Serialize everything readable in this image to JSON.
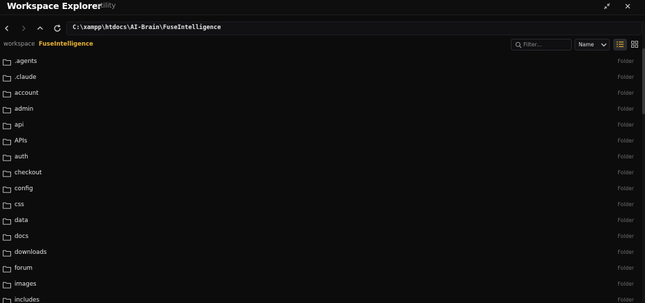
{
  "window": {
    "title": "Workspace Explorer",
    "subtitle": "utility"
  },
  "path": {
    "value": "C:\\xampp\\htdocs\\AI-Brain\\FuseIntelligence"
  },
  "breadcrumb": {
    "root": "workspace",
    "current": "FuseIntelligence"
  },
  "filter": {
    "placeholder": "Filter..."
  },
  "sort": {
    "label": "Name"
  },
  "colors": {
    "accent": "#e8b233",
    "background": "#0c0c0d"
  },
  "files": [
    {
      "name": ".agents",
      "type": "Folder"
    },
    {
      "name": ".claude",
      "type": "Folder"
    },
    {
      "name": "account",
      "type": "Folder"
    },
    {
      "name": "admin",
      "type": "Folder"
    },
    {
      "name": "api",
      "type": "Folder"
    },
    {
      "name": "APIs",
      "type": "Folder"
    },
    {
      "name": "auth",
      "type": "Folder"
    },
    {
      "name": "checkout",
      "type": "Folder"
    },
    {
      "name": "config",
      "type": "Folder"
    },
    {
      "name": "css",
      "type": "Folder"
    },
    {
      "name": "data",
      "type": "Folder"
    },
    {
      "name": "docs",
      "type": "Folder"
    },
    {
      "name": "downloads",
      "type": "Folder"
    },
    {
      "name": "forum",
      "type": "Folder"
    },
    {
      "name": "images",
      "type": "Folder"
    },
    {
      "name": "includes",
      "type": "Folder"
    }
  ]
}
